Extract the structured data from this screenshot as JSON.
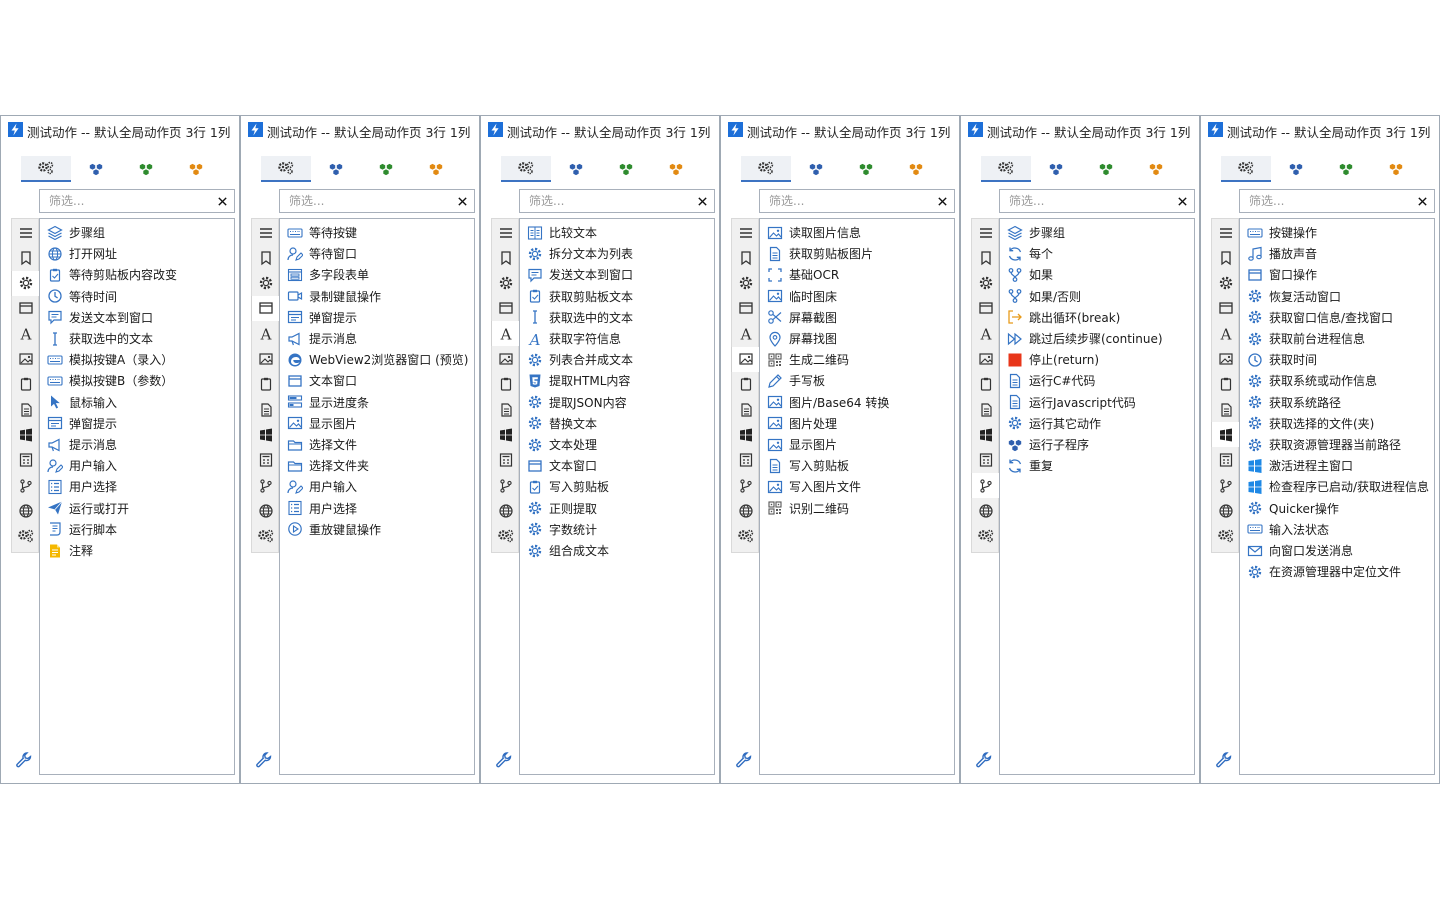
{
  "panel_title": "测试动作 -- 默认全局动作页 3行 1列",
  "search_placeholder": "筛选...",
  "tab_icons": [
    "gears-icon",
    "cubes-blue-icon",
    "cubes-green-icon",
    "cubes-orange-icon"
  ],
  "sidebar_icons": [
    "menu-icon",
    "bookmark-icon",
    "gear-icon",
    "window-icon",
    "text-icon",
    "image-icon",
    "clipboard-icon",
    "document-icon",
    "windows-icon",
    "calculator-icon",
    "branch-icon",
    "globe-icon",
    "gears-icon"
  ],
  "panels": [
    {
      "active_sidebar": 2,
      "items": [
        {
          "label": "步骤组",
          "icon": "layers-icon"
        },
        {
          "label": "打开网址",
          "icon": "globe-icon"
        },
        {
          "label": "等待剪贴板内容改变",
          "icon": "clipboard-icon"
        },
        {
          "label": "等待时间",
          "icon": "clock-icon"
        },
        {
          "label": "发送文本到窗口",
          "icon": "chat-icon"
        },
        {
          "label": "获取选中的文本",
          "icon": "cursor-text-icon"
        },
        {
          "label": "模拟按键A（录入）",
          "icon": "keyboard-icon"
        },
        {
          "label": "模拟按键B（参数）",
          "icon": "keyboard-icon"
        },
        {
          "label": "鼠标输入",
          "icon": "pointer-icon"
        },
        {
          "label": "弹窗提示",
          "icon": "popup-icon"
        },
        {
          "label": "提示消息",
          "icon": "megaphone-icon"
        },
        {
          "label": "用户输入",
          "icon": "user-edit-icon"
        },
        {
          "label": "用户选择",
          "icon": "list-icon"
        },
        {
          "label": "运行或打开",
          "icon": "send-icon"
        },
        {
          "label": "运行脚本",
          "icon": "script-icon"
        },
        {
          "label": "注释",
          "icon": "note-icon"
        }
      ]
    },
    {
      "active_sidebar": 3,
      "items": [
        {
          "label": "等待按键",
          "icon": "keyboard-icon"
        },
        {
          "label": "等待窗口",
          "icon": "user-edit-icon"
        },
        {
          "label": "多字段表单",
          "icon": "form-icon"
        },
        {
          "label": "录制键鼠操作",
          "icon": "record-icon"
        },
        {
          "label": "弹窗提示",
          "icon": "popup-icon"
        },
        {
          "label": "提示消息",
          "icon": "megaphone-icon"
        },
        {
          "label": "WebView2浏览器窗口 (预览)",
          "icon": "edge-icon"
        },
        {
          "label": "文本窗口",
          "icon": "window-icon"
        },
        {
          "label": "显示进度条",
          "icon": "progress-icon"
        },
        {
          "label": "显示图片",
          "icon": "image-icon"
        },
        {
          "label": "选择文件",
          "icon": "folder-icon"
        },
        {
          "label": "选择文件夹",
          "icon": "folder-icon"
        },
        {
          "label": "用户输入",
          "icon": "user-edit-icon"
        },
        {
          "label": "用户选择",
          "icon": "list-icon"
        },
        {
          "label": "重放键鼠操作",
          "icon": "play-icon"
        }
      ]
    },
    {
      "active_sidebar": 4,
      "items": [
        {
          "label": "比较文本",
          "icon": "compare-icon"
        },
        {
          "label": "拆分文本为列表",
          "icon": "gear-icon"
        },
        {
          "label": "发送文本到窗口",
          "icon": "chat-icon"
        },
        {
          "label": "获取剪贴板文本",
          "icon": "clipboard-icon"
        },
        {
          "label": "获取选中的文本",
          "icon": "cursor-text-icon"
        },
        {
          "label": "获取字符信息",
          "icon": "text-icon"
        },
        {
          "label": "列表合并成文本",
          "icon": "gear-icon"
        },
        {
          "label": "提取HTML内容",
          "icon": "html5-icon"
        },
        {
          "label": "提取JSON内容",
          "icon": "gear-icon"
        },
        {
          "label": "替换文本",
          "icon": "gear-icon"
        },
        {
          "label": "文本处理",
          "icon": "gear-icon"
        },
        {
          "label": "文本窗口",
          "icon": "window-icon"
        },
        {
          "label": "写入剪贴板",
          "icon": "clipboard-icon"
        },
        {
          "label": "正则提取",
          "icon": "gear-icon"
        },
        {
          "label": "字数统计",
          "icon": "gear-icon"
        },
        {
          "label": "组合成文本",
          "icon": "gear-icon"
        }
      ]
    },
    {
      "active_sidebar": 5,
      "items": [
        {
          "label": "读取图片信息",
          "icon": "image-icon"
        },
        {
          "label": "获取剪贴板图片",
          "icon": "document-icon"
        },
        {
          "label": "基础OCR",
          "icon": "scan-icon"
        },
        {
          "label": "临时图床",
          "icon": "image-icon"
        },
        {
          "label": "屏幕截图",
          "icon": "scissors-icon"
        },
        {
          "label": "屏幕找图",
          "icon": "location-icon"
        },
        {
          "label": "生成二维码",
          "icon": "qrcode-icon"
        },
        {
          "label": "手写板",
          "icon": "pen-icon"
        },
        {
          "label": "图片/Base64 转换",
          "icon": "image-icon"
        },
        {
          "label": "图片处理",
          "icon": "image-icon"
        },
        {
          "label": "显示图片",
          "icon": "image-icon"
        },
        {
          "label": "写入剪贴板",
          "icon": "document-icon"
        },
        {
          "label": "写入图片文件",
          "icon": "image-icon"
        },
        {
          "label": "识别二维码",
          "icon": "qrcode-icon"
        }
      ]
    },
    {
      "active_sidebar": 10,
      "items": [
        {
          "label": "步骤组",
          "icon": "layers-icon"
        },
        {
          "label": "每个",
          "icon": "loop-icon"
        },
        {
          "label": "如果",
          "icon": "branch-icon"
        },
        {
          "label": "如果/否则",
          "icon": "branch-icon"
        },
        {
          "label": "跳出循环(break)",
          "icon": "exit-icon"
        },
        {
          "label": "跳过后续步骤(continue)",
          "icon": "skip-icon"
        },
        {
          "label": "停止(return)",
          "icon": "stop-icon"
        },
        {
          "label": "运行C#代码",
          "icon": "document-icon"
        },
        {
          "label": "运行Javascript代码",
          "icon": "document-icon"
        },
        {
          "label": "运行其它动作",
          "icon": "gear-icon"
        },
        {
          "label": "运行子程序",
          "icon": "cubes-blue-icon"
        },
        {
          "label": "重复",
          "icon": "loop-icon"
        }
      ]
    },
    {
      "active_sidebar": 8,
      "items": [
        {
          "label": "按键操作",
          "icon": "keyboard-icon"
        },
        {
          "label": "播放声音",
          "icon": "music-icon"
        },
        {
          "label": "窗口操作",
          "icon": "window-icon"
        },
        {
          "label": "恢复活动窗口",
          "icon": "gear-icon"
        },
        {
          "label": "获取窗口信息/查找窗口",
          "icon": "gear-icon"
        },
        {
          "label": "获取前台进程信息",
          "icon": "gear-icon"
        },
        {
          "label": "获取时间",
          "icon": "clock-icon"
        },
        {
          "label": "获取系统或动作信息",
          "icon": "gear-icon"
        },
        {
          "label": "获取系统路径",
          "icon": "gear-icon"
        },
        {
          "label": "获取选择的文件(夹)",
          "icon": "gear-icon"
        },
        {
          "label": "获取资源管理器当前路径",
          "icon": "gear-icon"
        },
        {
          "label": "激活进程主窗口",
          "icon": "windows-logo-icon"
        },
        {
          "label": "检查程序已启动/获取进程信息",
          "icon": "windows-logo-icon"
        },
        {
          "label": "Quicker操作",
          "icon": "gear-icon"
        },
        {
          "label": "输入法状态",
          "icon": "keyboard-icon"
        },
        {
          "label": "向窗口发送消息",
          "icon": "mail-icon"
        },
        {
          "label": "在资源管理器中定位文件",
          "icon": "gear-icon"
        }
      ]
    }
  ]
}
